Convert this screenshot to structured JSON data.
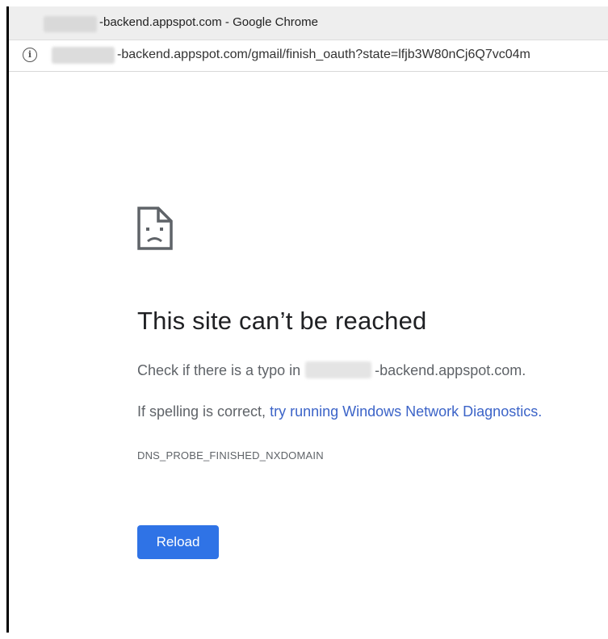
{
  "window": {
    "title": "-backend.appspot.com - Google Chrome"
  },
  "address_bar": {
    "url": "-backend.appspot.com/gmail/finish_oauth?state=lfjb3W80nCj6Q7vc04m",
    "info_icon": "info-icon"
  },
  "error_page": {
    "icon": "sad-page-icon",
    "heading": "This site can’t be reached",
    "typo_prefix": "Check if there is a typo in",
    "typo_domain": "-backend.appspot.com.",
    "spelling_prefix": "If spelling is correct,",
    "diagnostics_link": "try running Windows Network Diagnostics.",
    "error_code": "DNS_PROBE_FINISHED_NXDOMAIN",
    "reload_label": "Reload"
  },
  "colors": {
    "link": "#3c64c8",
    "button": "#2f73e6",
    "text_secondary": "#5f6368",
    "heading": "#202124"
  }
}
